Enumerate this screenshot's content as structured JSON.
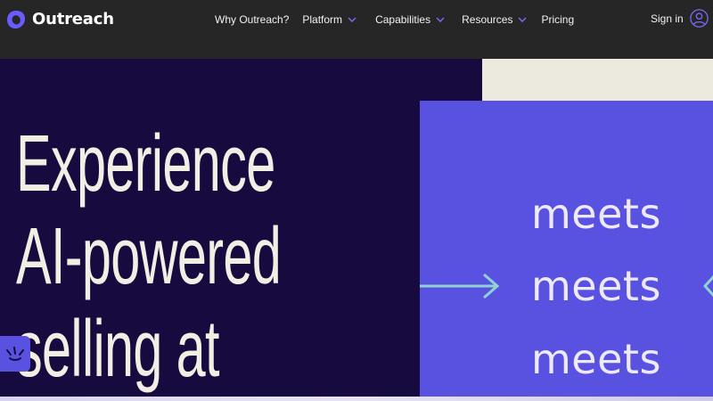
{
  "brand": {
    "name": "Outreach",
    "logo_icon": "outreach-logo-icon",
    "accent": "#5952e1",
    "dark": "#160a3f",
    "nav_bg": "#262626",
    "cream": "#ece9df",
    "headline_color": "#f3eee4"
  },
  "nav": {
    "items": [
      {
        "label": "Why Outreach?",
        "has_menu": false
      },
      {
        "label": "Platform",
        "has_menu": true
      },
      {
        "label": "Capabilities",
        "has_menu": true
      },
      {
        "label": "Resources",
        "has_menu": true
      },
      {
        "label": "Pricing",
        "has_menu": false
      }
    ],
    "signin_label": "Sign in",
    "signin_icon": "user-circle-icon",
    "chevron_icon": "chevron-down-icon"
  },
  "hero": {
    "headline_lines": [
      "Experience",
      "AI-powered",
      "selling at"
    ],
    "rotating_words": [
      "meets",
      "meets",
      "meets"
    ],
    "arrow_icon": "arrow-right-icon"
  },
  "chat_widget": {
    "icon": "chat-sparkle-icon"
  }
}
